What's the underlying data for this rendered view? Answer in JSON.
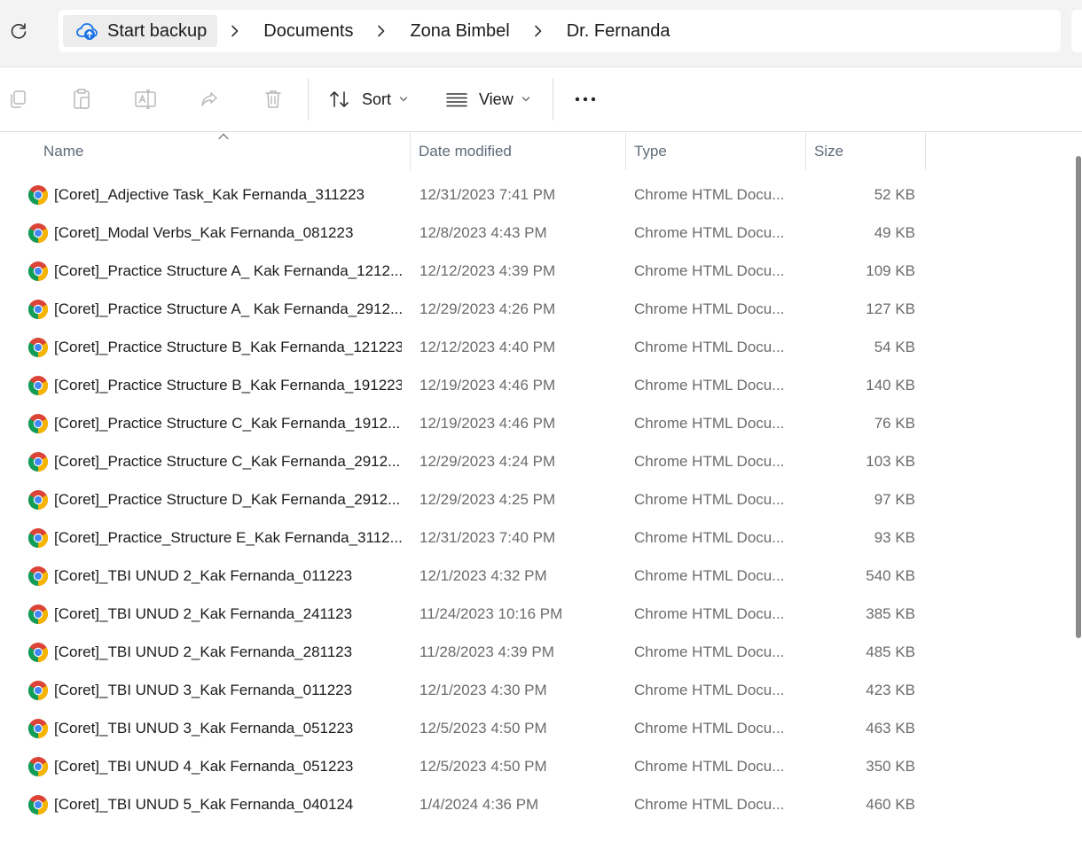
{
  "address_bar": {
    "root_label": "Start backup",
    "path": [
      "Documents",
      "Zona Bimbel",
      "Dr. Fernanda"
    ]
  },
  "command_bar": {
    "sort_label": "Sort",
    "view_label": "View"
  },
  "columns": {
    "name": "Name",
    "date": "Date modified",
    "type": "Type",
    "size": "Size"
  },
  "files": [
    {
      "name": "[Coret]_Adjective Task_Kak Fernanda_311223",
      "date": "12/31/2023 7:41 PM",
      "type": "Chrome HTML Docu...",
      "size": "52 KB"
    },
    {
      "name": "[Coret]_Modal Verbs_Kak Fernanda_081223",
      "date": "12/8/2023 4:43 PM",
      "type": "Chrome HTML Docu...",
      "size": "49 KB"
    },
    {
      "name": "[Coret]_Practice Structure A_ Kak Fernanda_1212...",
      "date": "12/12/2023 4:39 PM",
      "type": "Chrome HTML Docu...",
      "size": "109 KB"
    },
    {
      "name": "[Coret]_Practice Structure A_ Kak Fernanda_2912...",
      "date": "12/29/2023 4:26 PM",
      "type": "Chrome HTML Docu...",
      "size": "127 KB"
    },
    {
      "name": "[Coret]_Practice Structure B_Kak Fernanda_121223",
      "date": "12/12/2023 4:40 PM",
      "type": "Chrome HTML Docu...",
      "size": "54 KB"
    },
    {
      "name": "[Coret]_Practice Structure B_Kak Fernanda_191223",
      "date": "12/19/2023 4:46 PM",
      "type": "Chrome HTML Docu...",
      "size": "140 KB"
    },
    {
      "name": "[Coret]_Practice Structure C_Kak Fernanda_1912...",
      "date": "12/19/2023 4:46 PM",
      "type": "Chrome HTML Docu...",
      "size": "76 KB"
    },
    {
      "name": "[Coret]_Practice Structure C_Kak Fernanda_2912...",
      "date": "12/29/2023 4:24 PM",
      "type": "Chrome HTML Docu...",
      "size": "103 KB"
    },
    {
      "name": "[Coret]_Practice Structure D_Kak Fernanda_2912...",
      "date": "12/29/2023 4:25 PM",
      "type": "Chrome HTML Docu...",
      "size": "97 KB"
    },
    {
      "name": "[Coret]_Practice_Structure E_Kak Fernanda_3112...",
      "date": "12/31/2023 7:40 PM",
      "type": "Chrome HTML Docu...",
      "size": "93 KB"
    },
    {
      "name": "[Coret]_TBI UNUD 2_Kak Fernanda_011223",
      "date": "12/1/2023 4:32 PM",
      "type": "Chrome HTML Docu...",
      "size": "540 KB"
    },
    {
      "name": "[Coret]_TBI UNUD 2_Kak Fernanda_241123",
      "date": "11/24/2023 10:16 PM",
      "type": "Chrome HTML Docu...",
      "size": "385 KB"
    },
    {
      "name": "[Coret]_TBI UNUD 2_Kak Fernanda_281123",
      "date": "11/28/2023 4:39 PM",
      "type": "Chrome HTML Docu...",
      "size": "485 KB"
    },
    {
      "name": "[Coret]_TBI UNUD 3_Kak Fernanda_011223",
      "date": "12/1/2023 4:30 PM",
      "type": "Chrome HTML Docu...",
      "size": "423 KB"
    },
    {
      "name": "[Coret]_TBI UNUD 3_Kak Fernanda_051223",
      "date": "12/5/2023 4:50 PM",
      "type": "Chrome HTML Docu...",
      "size": "463 KB"
    },
    {
      "name": "[Coret]_TBI UNUD 4_Kak Fernanda_051223",
      "date": "12/5/2023 4:50 PM",
      "type": "Chrome HTML Docu...",
      "size": "350 KB"
    },
    {
      "name": "[Coret]_TBI UNUD 5_Kak Fernanda_040124",
      "date": "1/4/2024 4:36 PM",
      "type": "Chrome HTML Docu...",
      "size": "460 KB"
    }
  ],
  "colors": {
    "chrome_red": "#db4437",
    "chrome_green": "#0f9d58",
    "chrome_yellow": "#f4b400",
    "chrome_blue": "#4285f4",
    "cloud_blue": "#1a73e8"
  },
  "icons": {
    "refresh": "refresh-icon",
    "cloud": "cloud-upload-icon",
    "copy": "copy-icon",
    "paste": "paste-icon",
    "rename": "rename-icon",
    "share": "share-icon",
    "delete": "delete-icon",
    "sort": "sort-icon",
    "view": "view-icon",
    "more": "more-icon",
    "file": "chrome-icon"
  }
}
